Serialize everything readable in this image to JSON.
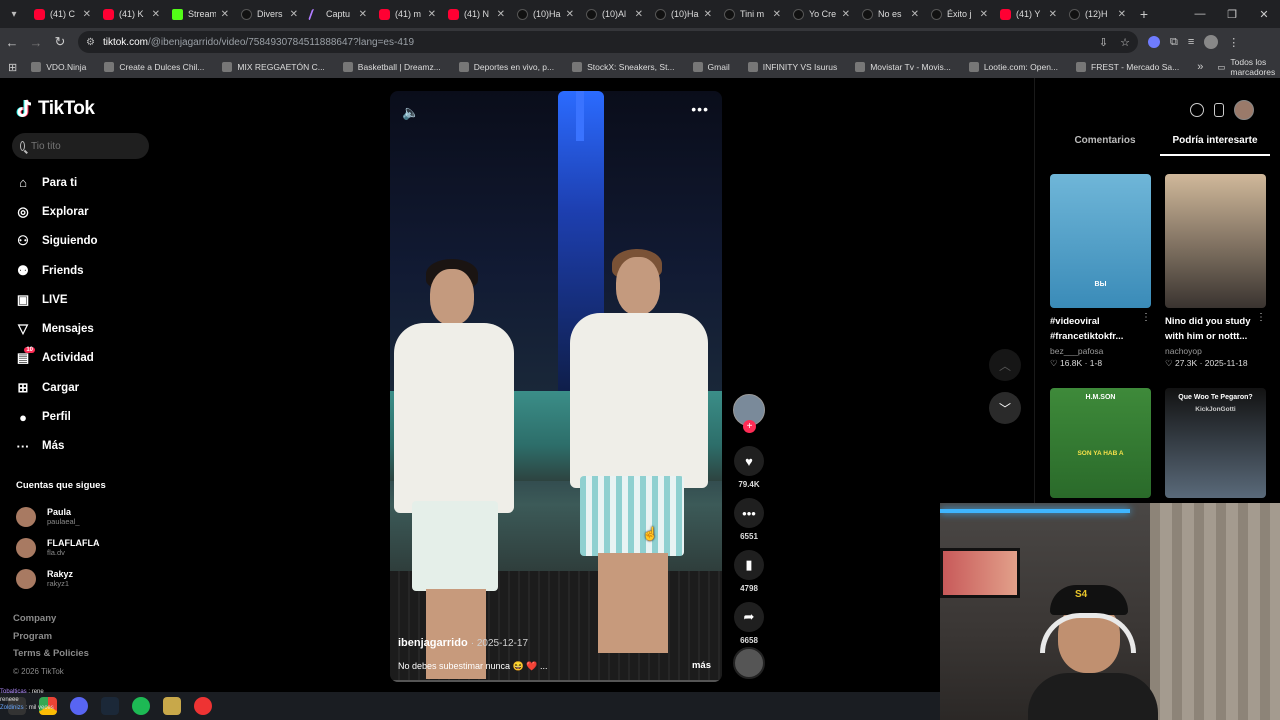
{
  "browser": {
    "tabs": [
      {
        "title": "(41) C",
        "type": "yt"
      },
      {
        "title": "(41) K",
        "type": "yt"
      },
      {
        "title": "Stream",
        "type": "kick"
      },
      {
        "title": "Divers",
        "type": "tt"
      },
      {
        "title": "Captu",
        "type": "mag"
      },
      {
        "title": "(41) m",
        "type": "yt"
      },
      {
        "title": "(41) N",
        "type": "yt"
      },
      {
        "title": "(10)Ha",
        "type": "tt"
      },
      {
        "title": "(10)Al",
        "type": "tt"
      },
      {
        "title": "(10)Ha",
        "type": "tt"
      },
      {
        "title": "Tini m",
        "type": "tt"
      },
      {
        "title": "Yo Cre",
        "type": "tt"
      },
      {
        "title": "No es",
        "type": "tt"
      },
      {
        "title": "Éxito j",
        "type": "tt"
      },
      {
        "title": "(41) Y",
        "type": "yt"
      },
      {
        "title": "(12)H",
        "type": "tt"
      }
    ],
    "url_domain": "tiktok.com",
    "url_rest": "/@ibenjagarrido/video/7584930784511888647?lang=es-419",
    "bookmarks": [
      "VDO.Ninja",
      "Create a Dulces Chil...",
      "MIX REGGAETÓN C...",
      "Basketball | Dreamz...",
      "Deportes en vivo, p...",
      "StockX: Sneakers, St...",
      "Gmail",
      "INFINITY VS Isurus",
      "Movistar Tv - Movis...",
      "Lootie.com: Open...",
      "FREST - Mercado Sa..."
    ],
    "bookmarks_all": "Todos los marcadores"
  },
  "tiktok": {
    "logo": "TikTok",
    "search_placeholder": "Tio tito",
    "menu": [
      {
        "label": "Para ti",
        "icon": "home-icon",
        "glyph": "⌂"
      },
      {
        "label": "Explorar",
        "icon": "compass-icon",
        "glyph": "◎"
      },
      {
        "label": "Siguiendo",
        "icon": "following-icon",
        "glyph": "⚇"
      },
      {
        "label": "Friends",
        "icon": "friends-icon",
        "glyph": "⚉"
      },
      {
        "label": "LIVE",
        "icon": "live-icon",
        "glyph": "▣"
      },
      {
        "label": "Mensajes",
        "icon": "messages-icon",
        "glyph": "▽"
      },
      {
        "label": "Actividad",
        "icon": "activity-icon",
        "glyph": "▤",
        "badge": "10"
      },
      {
        "label": "Cargar",
        "icon": "upload-icon",
        "glyph": "⊞"
      },
      {
        "label": "Perfil",
        "icon": "profile-avatar-icon",
        "glyph": "●"
      },
      {
        "label": "Más",
        "icon": "more-icon",
        "glyph": "···"
      }
    ],
    "following_title": "Cuentas que sigues",
    "following": [
      {
        "name": "Paula",
        "handle": "paulaeal_"
      },
      {
        "name": "FLAFLAFLA",
        "handle": "fla.dv"
      },
      {
        "name": "Rakyz",
        "handle": "rakyz1"
      }
    ],
    "footer": [
      "Company",
      "Program",
      "Terms & Policies"
    ],
    "copyright": "© 2026 TikTok",
    "video": {
      "author": "ibenjagarrido",
      "date": "2025-12-17",
      "caption": "No debes subestimar nunca 😆 ❤️ ...",
      "more": "más",
      "likes": "79.4K",
      "comments": "6551",
      "saves": "4798",
      "shares": "6658"
    },
    "right_tabs": [
      "Comentarios",
      "Podría interesarte"
    ],
    "cards": [
      {
        "title": "#videoviral #francetiktokfr...",
        "author": "bez___pafosa",
        "likes": "16.8K",
        "date": "1-8",
        "thumb_text": "BЫ",
        "colors": [
          "#6fb6d8",
          "#3a8bb8"
        ]
      },
      {
        "title": "Nino did you study with him or nottt...",
        "author": "nachoyop",
        "likes": "27.3K",
        "date": "2025-11-18",
        "thumb_text": "",
        "colors": [
          "#d0b89a",
          "#3a3430"
        ]
      },
      {
        "title": "",
        "author": "",
        "likes": "",
        "date": "",
        "thumb_text": "H.M.SON",
        "thumb_text2": "SON YA HAB A",
        "colors": [
          "#3e8a3a",
          "#2a6a2a"
        ]
      },
      {
        "title": "",
        "author": "",
        "likes": "",
        "date": "",
        "thumb_text": "Que Woo Te Pegaron?",
        "thumb_text2": "KickJonGotti",
        "colors": [
          "#121212",
          "#5a6a7a"
        ]
      }
    ]
  },
  "stream_overlay": {
    "chat": [
      {
        "user": "Tobalticas",
        "text": "rene"
      },
      {
        "user": "",
        "text": "reneee"
      },
      {
        "user": "Zoldinizs",
        "text": "mil veces"
      }
    ],
    "cap_logo": "S4"
  }
}
